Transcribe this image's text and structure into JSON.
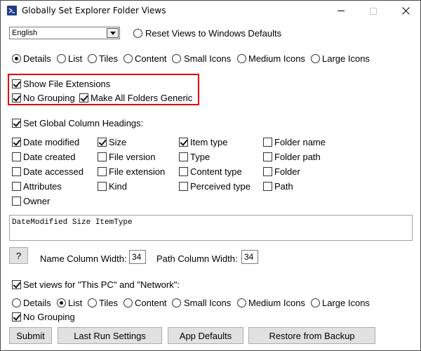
{
  "window": {
    "title": "Globally Set Explorer Folder Views"
  },
  "language": {
    "selected": "English"
  },
  "reset_defaults_label": "Reset Views to Windows Defaults",
  "view_modes": {
    "details": "Details",
    "list": "List",
    "tiles": "Tiles",
    "content": "Content",
    "small": "Small Icons",
    "medium": "Medium Icons",
    "large": "Large Icons",
    "selected": "Details"
  },
  "options": {
    "show_extensions": "Show File Extensions",
    "no_grouping": "No Grouping",
    "make_generic": "Make All Folders Generic"
  },
  "column_headings": {
    "label": "Set Global Column Headings:",
    "items": [
      {
        "label": "Date modified",
        "checked": true
      },
      {
        "label": "Date created",
        "checked": false
      },
      {
        "label": "Date accessed",
        "checked": false
      },
      {
        "label": "Attributes",
        "checked": false
      },
      {
        "label": "Owner",
        "checked": false
      },
      {
        "label": "Size",
        "checked": true
      },
      {
        "label": "File version",
        "checked": false
      },
      {
        "label": "File extension",
        "checked": false
      },
      {
        "label": "Kind",
        "checked": false
      },
      {
        "label": "Item type",
        "checked": true
      },
      {
        "label": "Type",
        "checked": false
      },
      {
        "label": "Content type",
        "checked": false
      },
      {
        "label": "Perceived type",
        "checked": false
      },
      {
        "label": "Folder name",
        "checked": false
      },
      {
        "label": "Folder path",
        "checked": false
      },
      {
        "label": "Folder",
        "checked": false
      },
      {
        "label": "Path",
        "checked": false
      }
    ],
    "value": "DateModified Size ItemType"
  },
  "widths": {
    "help": "?",
    "name_label": "Name Column Width:",
    "name_value": "34",
    "path_label": "Path Column Width:",
    "path_value": "34"
  },
  "pc_network": {
    "label": "Set views for \"This PC\" and \"Network\":",
    "selected": "List",
    "no_grouping": "No Grouping"
  },
  "buttons": {
    "submit": "Submit",
    "last_run": "Last Run Settings",
    "app_defaults": "App Defaults",
    "restore": "Restore from Backup"
  }
}
